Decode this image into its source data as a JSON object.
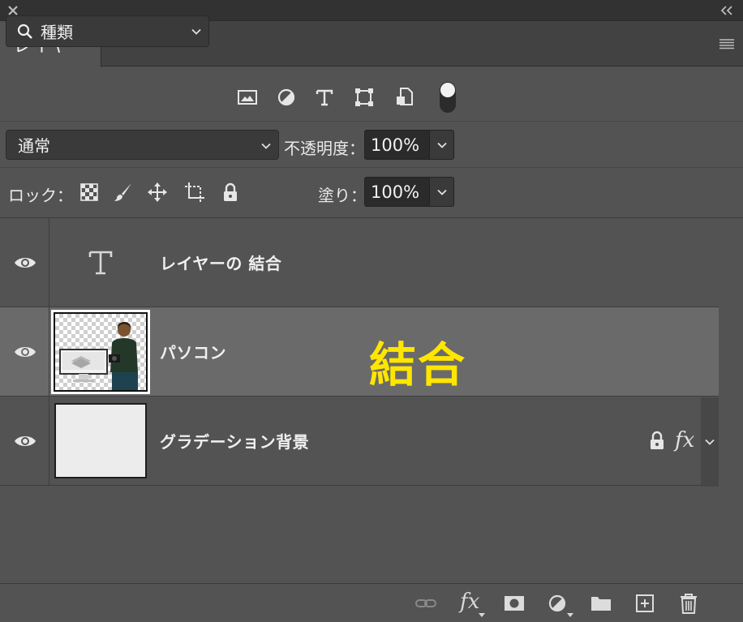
{
  "panel": {
    "tab_label": "レイヤー"
  },
  "filter": {
    "kind_label": "種類",
    "icons": [
      "image-filter-icon",
      "adjustment-filter-icon",
      "type-filter-icon",
      "shape-filter-icon",
      "smart-object-filter-icon"
    ],
    "toggle_on": true
  },
  "blend": {
    "mode": "通常",
    "opacity_label": "不透明度：",
    "opacity_value": "100%"
  },
  "lock": {
    "label": "ロック：",
    "icons": [
      "lock-transparent-pixels-icon",
      "lock-image-pixels-icon",
      "lock-position-icon",
      "lock-artboard-icon",
      "lock-all-icon"
    ],
    "fill_label": "塗り：",
    "fill_value": "100%"
  },
  "layers": [
    {
      "name": "レイヤーの 結合",
      "type": "text",
      "visible": true,
      "selected": false
    },
    {
      "name": "パソコン",
      "type": "image",
      "visible": true,
      "selected": true,
      "overlay_label": "結合"
    },
    {
      "name": "グラデーション背景",
      "type": "gradient",
      "visible": true,
      "selected": false,
      "locked": true,
      "effects_label": "fx"
    }
  ],
  "bottom_toolbar": {
    "fx_label": "fx",
    "icons": [
      "link-layers-icon",
      "add-layer-style-icon",
      "add-mask-icon",
      "new-adjustment-layer-icon",
      "new-group-icon",
      "new-layer-icon",
      "delete-layer-icon"
    ]
  },
  "colors": {
    "panel_bg": "#535353",
    "selected_row": "#6a6a6a",
    "overlay_text": "#ffe600"
  }
}
